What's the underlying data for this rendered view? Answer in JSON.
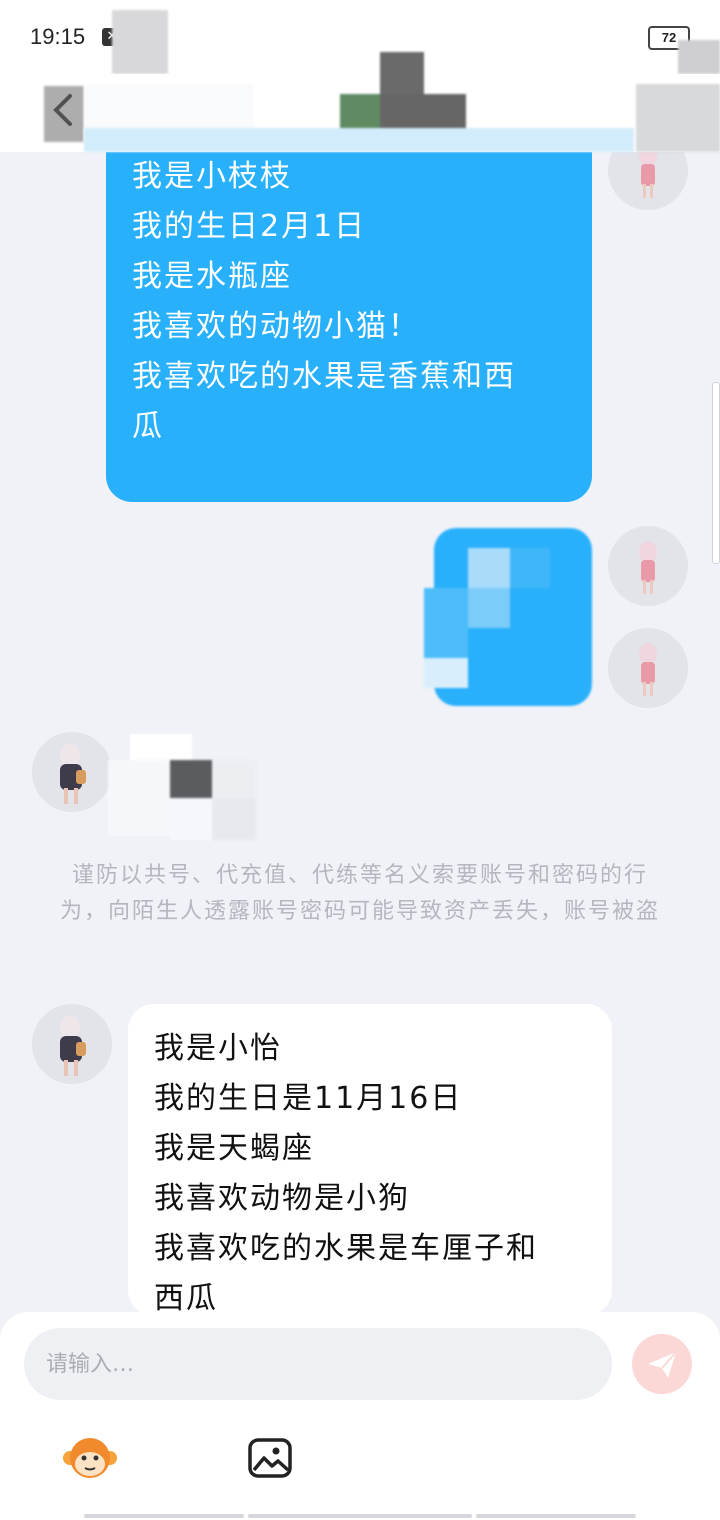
{
  "status_bar": {
    "time": "19:15",
    "battery": "72"
  },
  "notice": "谨防以共号、代充值、代练等名义索要账号和密码的行为，向陌生人透露账号密码可能导致资产丢失，账号被盗",
  "messages": {
    "sent_1": {
      "lines": [
        "我是小枝枝",
        "我的生日2月1日",
        "我是水瓶座",
        "我喜欢的动物小猫！",
        "我喜欢吃的水果是香蕉和西",
        "瓜"
      ]
    },
    "received_1": {
      "lines": [
        "我是小怡",
        "我的生日是11月16日",
        "我是天蝎座",
        "我喜欢动物是小狗",
        "我喜欢吃的水果是车厘子和",
        "西瓜"
      ]
    }
  },
  "composer": {
    "placeholder": "请输入…"
  },
  "colors": {
    "accent_blue": "#29b0fb",
    "send_disabled": "#fbd8d6",
    "background": "#f0f2f7"
  },
  "icons": {
    "back": "chevron-left-icon",
    "emoji": "monkey-emoji-icon",
    "image": "image-icon",
    "send": "paper-plane-icon"
  }
}
